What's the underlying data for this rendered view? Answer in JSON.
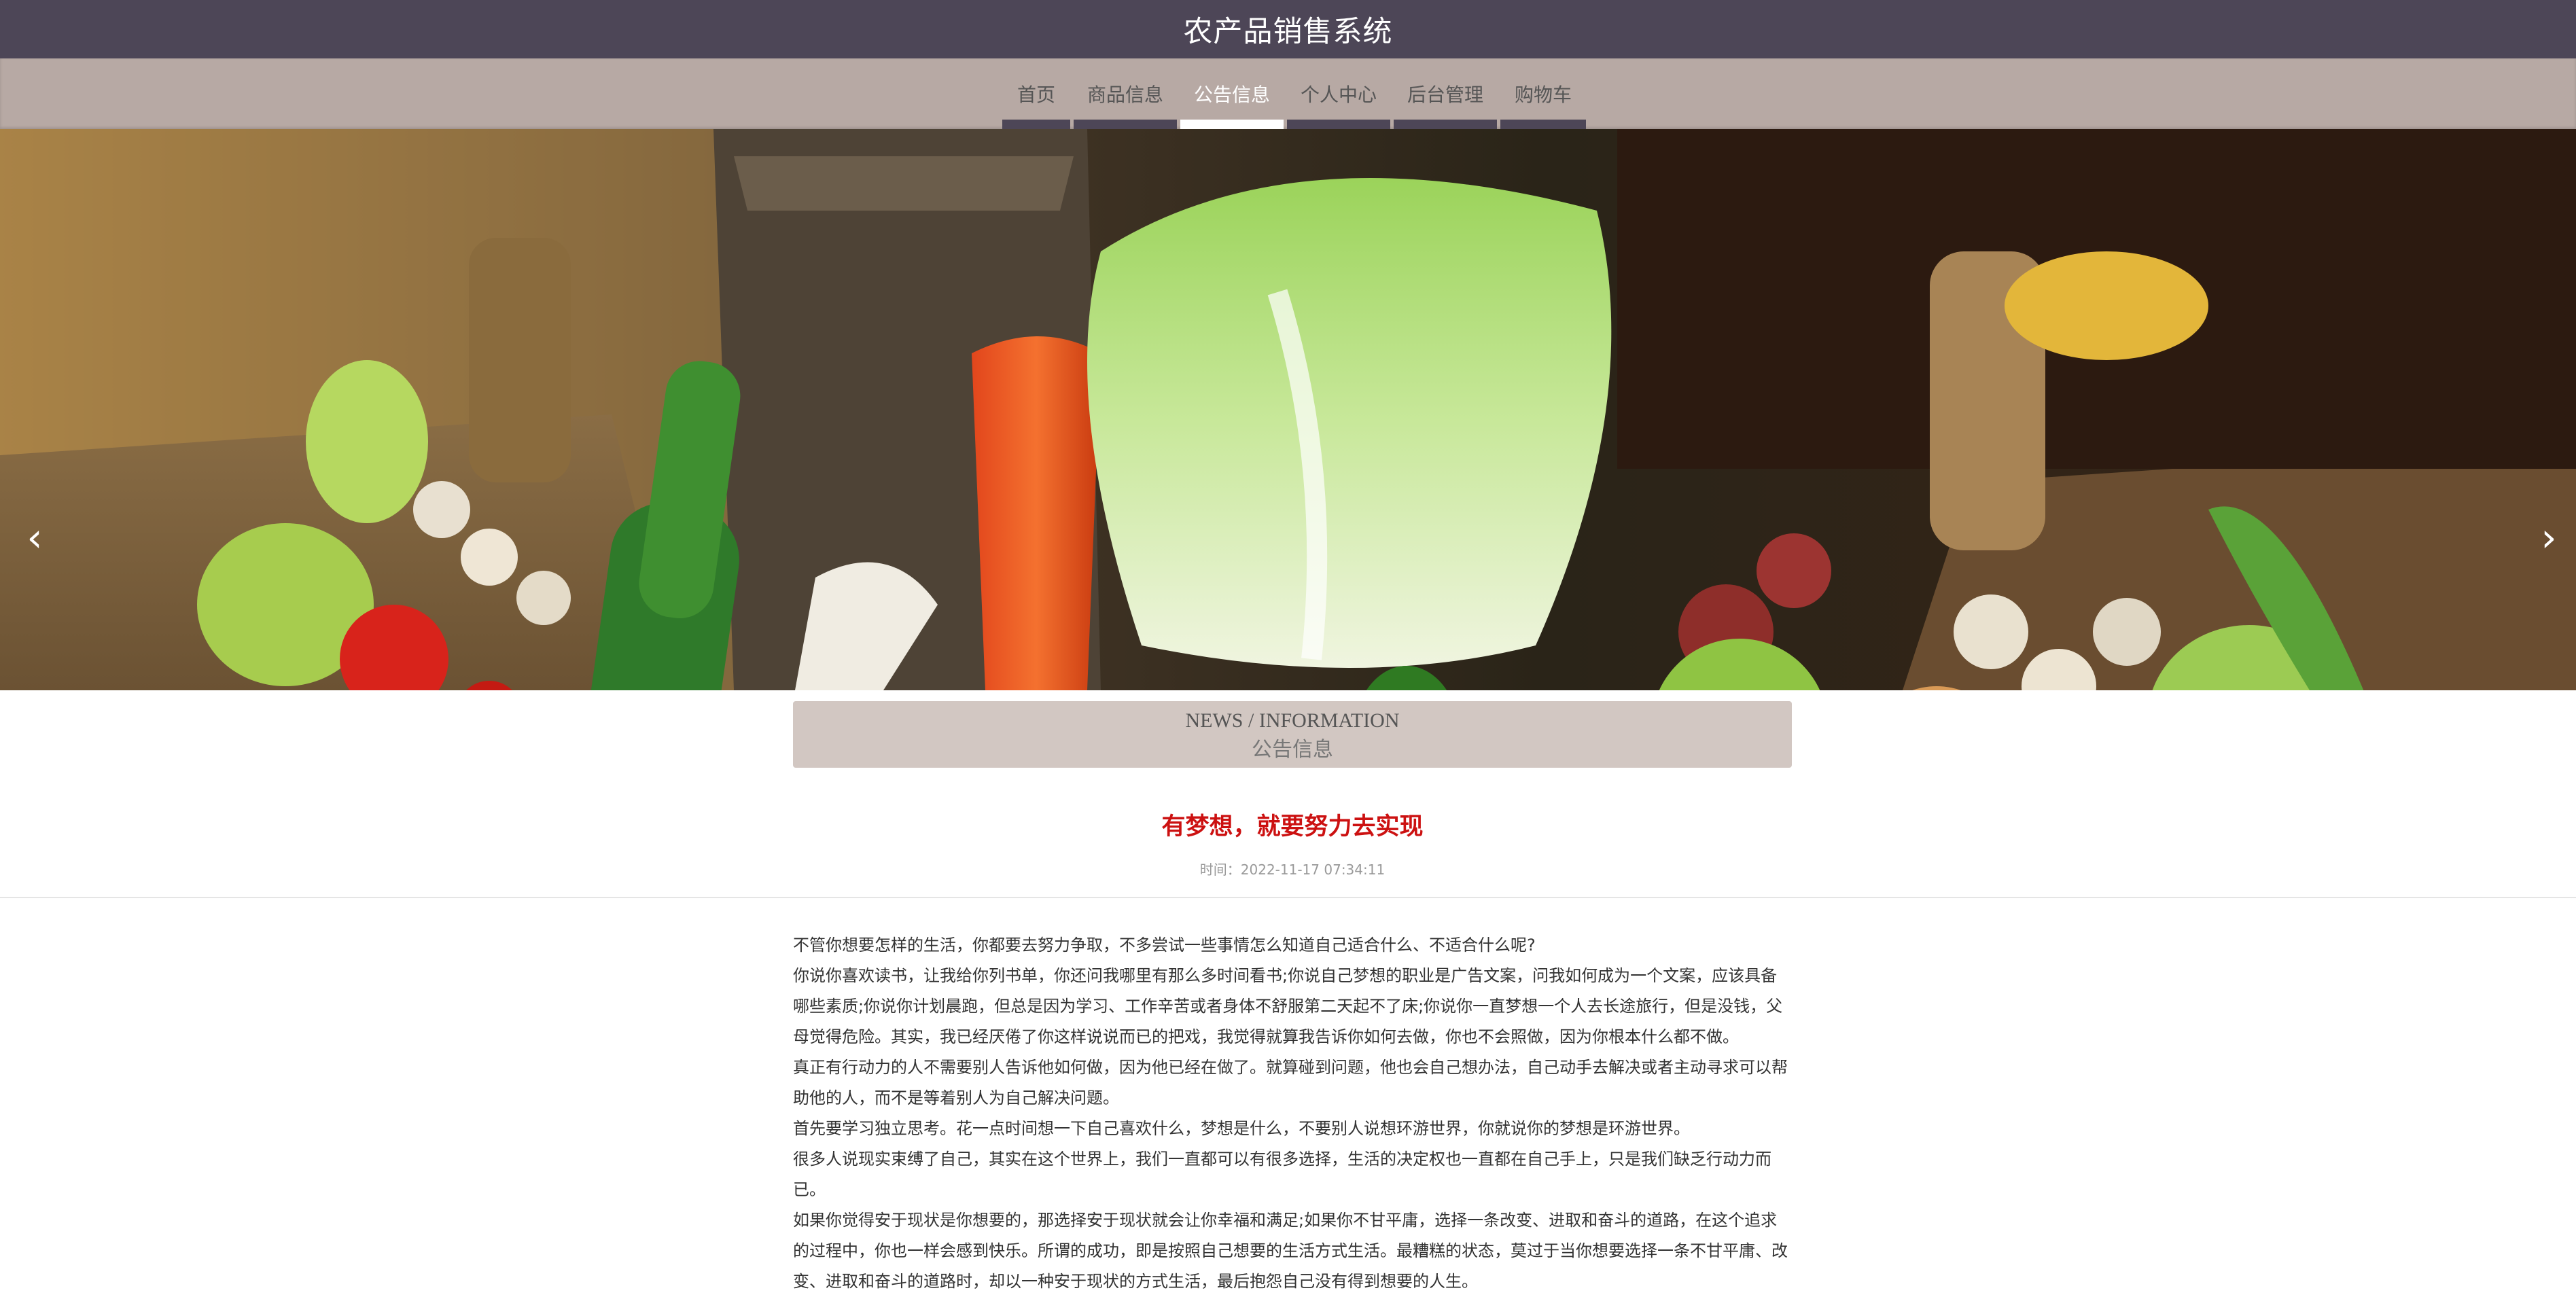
{
  "header": {
    "site_title": "农产品销售系统"
  },
  "nav": {
    "items": [
      {
        "label": "首页"
      },
      {
        "label": "商品信息"
      },
      {
        "label": "公告信息",
        "active": true
      },
      {
        "label": "个人中心"
      },
      {
        "label": "后台管理"
      },
      {
        "label": "购物车"
      }
    ]
  },
  "banner": {
    "prev_symbol": "‹",
    "next_symbol": "›",
    "slide_count": 3,
    "active_slide": 1
  },
  "section": {
    "title_en": "NEWS / INFORMATION",
    "title_zh": "公告信息"
  },
  "article": {
    "title": "有梦想，就要努力去实现",
    "time": "时间：2022-11-17 07:34:11",
    "paragraphs": [
      "不管你想要怎样的生活，你都要去努力争取，不多尝试一些事情怎么知道自己适合什么、不适合什么呢?",
      "你说你喜欢读书，让我给你列书单，你还问我哪里有那么多时间看书;你说自己梦想的职业是广告文案，问我如何成为一个文案，应该具备哪些素质;你说你计划晨跑，但总是因为学习、工作辛苦或者身体不舒服第二天起不了床;你说你一直梦想一个人去长途旅行，但是没钱，父母觉得危险。其实，我已经厌倦了你这样说说而已的把戏，我觉得就算我告诉你如何去做，你也不会照做，因为你根本什么都不做。",
      "真正有行动力的人不需要别人告诉他如何做，因为他已经在做了。就算碰到问题，他也会自己想办法，自己动手去解决或者主动寻求可以帮助他的人，而不是等着别人为自己解决问题。",
      "首先要学习独立思考。花一点时间想一下自己喜欢什么，梦想是什么，不要别人说想环游世界，你就说你的梦想是环游世界。",
      "很多人说现实束缚了自己，其实在这个世界上，我们一直都可以有很多选择，生活的决定权也一直都在自己手上，只是我们缺乏行动力而已。",
      "如果你觉得安于现状是你想要的，那选择安于现状就会让你幸福和满足;如果你不甘平庸，选择一条改变、进取和奋斗的道路，在这个追求的过程中，你也一样会感到快乐。所谓的成功，即是按照自己想要的生活方式生活。最糟糕的状态，莫过于当你想要选择一条不甘平庸、改变、进取和奋斗的道路时，却以一种安于现状的方式生活，最后抱怨自己没有得到想要的人生。"
    ]
  },
  "colors": {
    "topbar": "#4d4657",
    "navbar": "#b7a9a4",
    "section_header": "#d2c7c2",
    "article_title": "#cc1111"
  }
}
